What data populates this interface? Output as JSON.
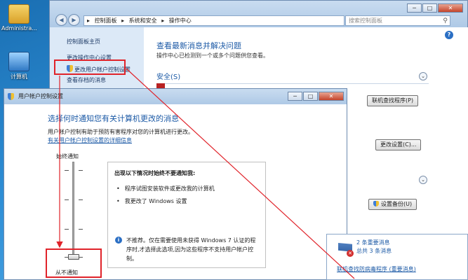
{
  "desktop": {
    "icons": [
      {
        "label": "Administra..."
      },
      {
        "label": "计算机"
      }
    ]
  },
  "main_window": {
    "address_segments": [
      "▸",
      "控制面板",
      "▸",
      "系统和安全",
      "▸",
      "操作中心"
    ],
    "search_placeholder": "搜索控制面板",
    "caption": {
      "minimize": "─",
      "maximize": "□",
      "close": "✕"
    },
    "nav": {
      "back": "◀",
      "forward": "▶"
    },
    "sidebar": {
      "items": [
        {
          "label": "控制面板主页"
        },
        {
          "label": "更改操作中心设置"
        },
        {
          "label": "更改用户帐户控制设置"
        },
        {
          "label": "查看存档的消息"
        }
      ]
    },
    "content": {
      "title": "查看最新消息并解决问题",
      "subtitle": "操作中心已检测到一个或多个问题供您查看。",
      "section_security": "安全(S)",
      "button_online": "联机查找程序(P)",
      "button_change": "更改设置(C)...",
      "button_backup": "设置备份(U)"
    }
  },
  "uac_dialog": {
    "title": "用户帐户控制设置",
    "heading": "选择何时通知您有关计算机更改的消息",
    "description": "用户帐户控制有助于预防有害程序对您的计算机进行更改。",
    "link": "有关用户帐户控制设置的详细信息",
    "label_always": "始终通知",
    "label_never": "从不通知",
    "slider_level": 0,
    "info_title": "出现以下情况时始终不要通知我:",
    "bullets": [
      "程序试图安装软件或更改我的计算机",
      "我更改了 Windows 设置"
    ],
    "info_note": "不推荐。仅在需要使用未获得 Windows 7 认证的程序时,才选择此选项,因为这些程序不支持用户帐户控制。",
    "caption": {
      "minimize": "─",
      "maximize": "□",
      "close": "✕"
    }
  },
  "notification": {
    "count": "2 条重要消息",
    "total": "总共 3 条消息",
    "link": "联机查找防病毒程序 (重要消息)"
  },
  "colors": {
    "highlight": "#e0232a",
    "link": "#1c5aa6"
  }
}
